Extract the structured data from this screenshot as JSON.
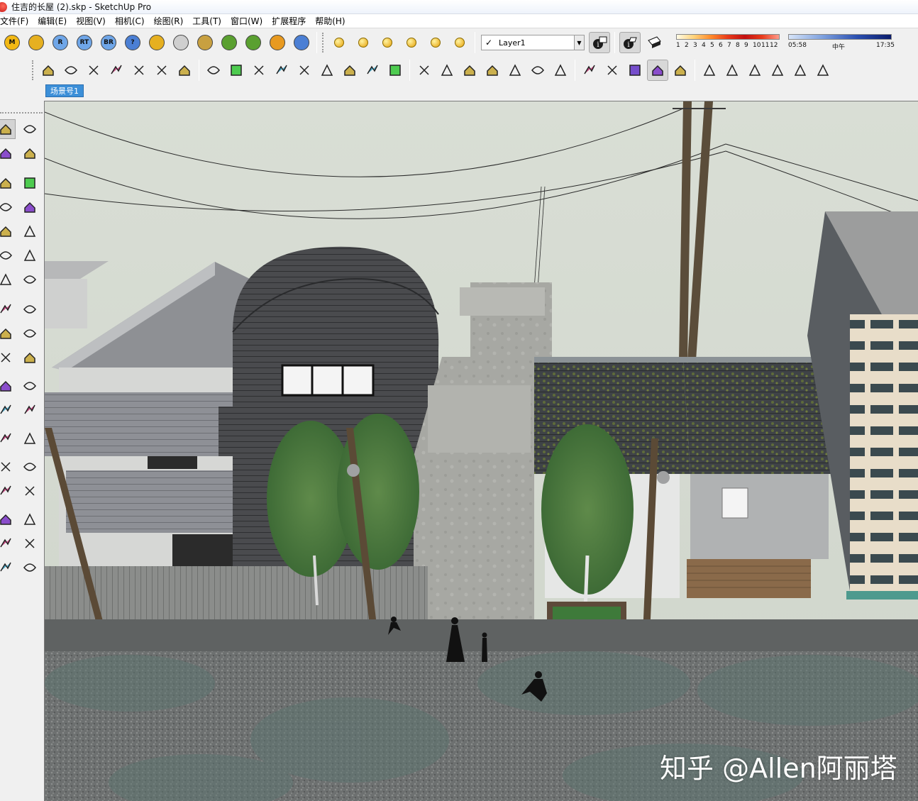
{
  "window": {
    "title": "住吉的长屋 (2).skp - SketchUp Pro"
  },
  "menu": [
    "文件(F)",
    "编辑(E)",
    "视图(V)",
    "相机(C)",
    "绘图(R)",
    "工具(T)",
    "窗口(W)",
    "扩展程序",
    "帮助(H)"
  ],
  "toolbar": {
    "plugin_buttons": [
      {
        "label": "M",
        "icon": "m-plugin-icon",
        "color": "#f2b814"
      },
      {
        "label": "",
        "icon": "tag-gem-icon",
        "color": "#e6b020"
      },
      {
        "label": "R",
        "icon": "r-plugin-icon",
        "color": "#6fa6e8"
      },
      {
        "label": "RT",
        "icon": "rt-plugin-icon",
        "color": "#6fa6e8"
      },
      {
        "label": "BR",
        "icon": "br-plugin-icon",
        "color": "#6fa6e8"
      },
      {
        "label": "?",
        "icon": "help-icon",
        "color": "#4b7fd4"
      },
      {
        "label": "",
        "icon": "tag-light-icon",
        "color": "#e6b020"
      },
      {
        "label": "",
        "icon": "sphere-icon",
        "color": "#cfcfcf"
      },
      {
        "label": "",
        "icon": "grass-icon",
        "color": "#c8a040"
      },
      {
        "label": "",
        "icon": "plant-icon",
        "color": "#5aa030"
      },
      {
        "label": "",
        "icon": "plant-alt-icon",
        "color": "#5aa030"
      },
      {
        "label": "",
        "icon": "target-icon",
        "color": "#e89a20"
      },
      {
        "label": "",
        "icon": "pause-icon",
        "color": "#4b7fd4"
      }
    ],
    "light_buttons": [
      "point-light-icon",
      "spot-light-icon",
      "flag-light-icon",
      "dome-light-icon",
      "sphere-light-icon",
      "ies-light-icon"
    ],
    "layer": {
      "checked": true,
      "name": "Layer1"
    },
    "shadow": {
      "months": [
        "1",
        "2",
        "3",
        "4",
        "5",
        "6",
        "7",
        "8",
        "9",
        "10",
        "11",
        "12"
      ],
      "time_start": "05:58",
      "time_mid": "中午",
      "time_end": "17:35"
    },
    "row2_icons": [
      "modify-icon",
      "house-cut-icon",
      "frame-icon",
      "grid-icon",
      "fence-icon",
      "panel-icon",
      "stairs-icon",
      "line-tool-icon",
      "arc-tool-icon",
      "check-curve-icon",
      "roof-curve-icon",
      "plank-icon",
      "red-box-icon",
      "spline-icon",
      "hook-curve-icon",
      "red-cube-icon",
      "stamp-icon",
      "sandbox-icon",
      "bridge-icon",
      "box-3d-icon",
      "grid-3d-icon",
      "edit-face-icon",
      "building-bars-icon",
      "wand-icon",
      "brush-icon",
      "rb-icon",
      "render-swirl-icon",
      "su-app-icon",
      "house-1-icon",
      "house-2-icon",
      "house-3-icon",
      "house-4-icon",
      "house-5-icon",
      "house-6-icon"
    ]
  },
  "scene_tab": "场景号1",
  "left_tools": [
    "select-icon",
    "component-icon",
    "paint-bucket-icon",
    "eraser-icon",
    "pencil-icon",
    "freehand-icon",
    "rectangle-icon",
    "rotated-rect-icon",
    "circle-icon",
    "polygon-icon",
    "arc-icon",
    "arc-2pt-icon",
    "arc-3pt-icon",
    "pie-icon",
    "move-icon",
    "push-pull-icon",
    "rotate-icon",
    "follow-me-icon",
    "scale-icon",
    "offset-icon",
    "tape-measure-icon",
    "dimension-icon",
    "protractor-icon",
    "text-icon",
    "axes-icon",
    "3d-text-icon",
    "orbit-icon",
    "pan-icon",
    "zoom-icon",
    "zoom-window-icon",
    "zoom-extents-icon",
    "previous-view-icon",
    "walk-icon",
    "look-around-icon",
    "footprints-icon",
    "position-camera-icon"
  ],
  "watermark": "知乎 @Allen阿丽塔"
}
